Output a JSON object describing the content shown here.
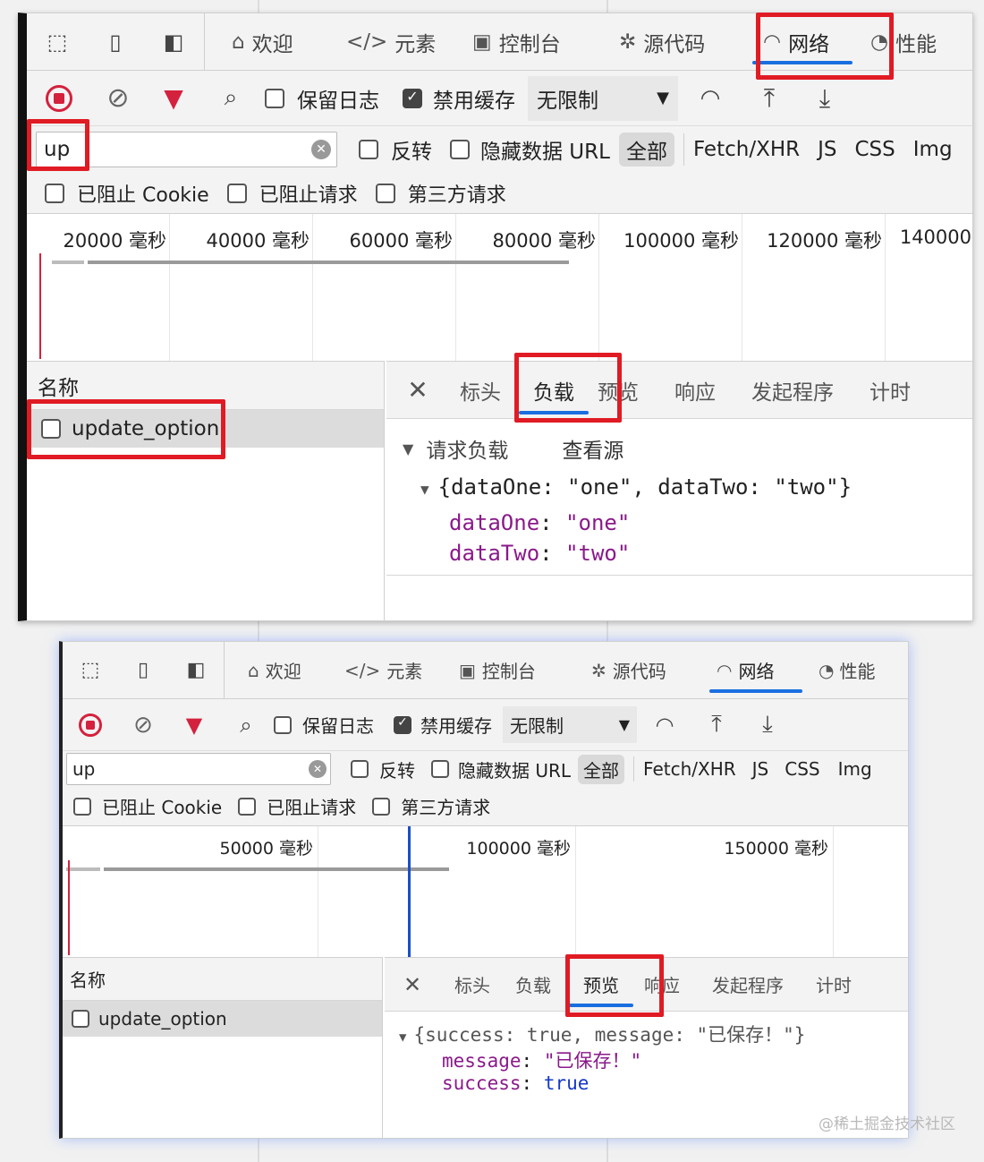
{
  "devtools_tabs": [
    {
      "label": "欢迎",
      "icon": "home-icon"
    },
    {
      "label": "元素",
      "icon": "code-icon"
    },
    {
      "label": "控制台",
      "icon": "console-icon"
    },
    {
      "label": "源代码",
      "icon": "bug-icon"
    },
    {
      "label": "网络",
      "icon": "wifi-icon"
    },
    {
      "label": "性能",
      "icon": "gauge-icon"
    }
  ],
  "toolbar": {
    "preserve_log": "保留日志",
    "disable_cache": "禁用缓存",
    "throttling": "无限制"
  },
  "filter": {
    "query": "up",
    "invert": "反转",
    "hide_data_urls": "隐藏数据 URL",
    "types": [
      "全部",
      "Fetch/XHR",
      "JS",
      "CSS",
      "Img"
    ],
    "blocked_cookies": "已阻止 Cookie",
    "blocked_requests": "已阻止请求",
    "third_party": "第三方请求"
  },
  "request_list": {
    "header": "名称",
    "items": [
      "update_option"
    ]
  },
  "detail_tabs": [
    "标头",
    "负载",
    "预览",
    "响应",
    "发起程序",
    "计时"
  ],
  "panel1": {
    "timeline_labels": [
      "20000 毫秒",
      "40000 毫秒",
      "60000 毫秒",
      "80000 毫秒",
      "100000 毫秒",
      "120000 毫秒",
      "140000"
    ],
    "active_tab": "负载",
    "payload": {
      "section": "请求负载",
      "view_source": "查看源",
      "summary": "{dataOne: \"one\", dataTwo: \"two\"}",
      "fields": [
        {
          "key": "dataOne",
          "value": "\"one\""
        },
        {
          "key": "dataTwo",
          "value": "\"two\""
        }
      ]
    }
  },
  "panel2": {
    "timeline_labels": [
      "50000 毫秒",
      "100000 毫秒",
      "150000 毫秒"
    ],
    "active_tab": "预览",
    "preview": {
      "summary": "{success: true, message: \"已保存！\"}",
      "fields": [
        {
          "key": "message",
          "value": "\"已保存！\"",
          "kind": "string"
        },
        {
          "key": "success",
          "value": "true",
          "kind": "bool"
        }
      ]
    }
  },
  "watermark": "@稀土掘金技术社区",
  "colors": {
    "highlight": "#e01b24",
    "active_tab": "#1a6fe0",
    "record": "#d4213d"
  }
}
